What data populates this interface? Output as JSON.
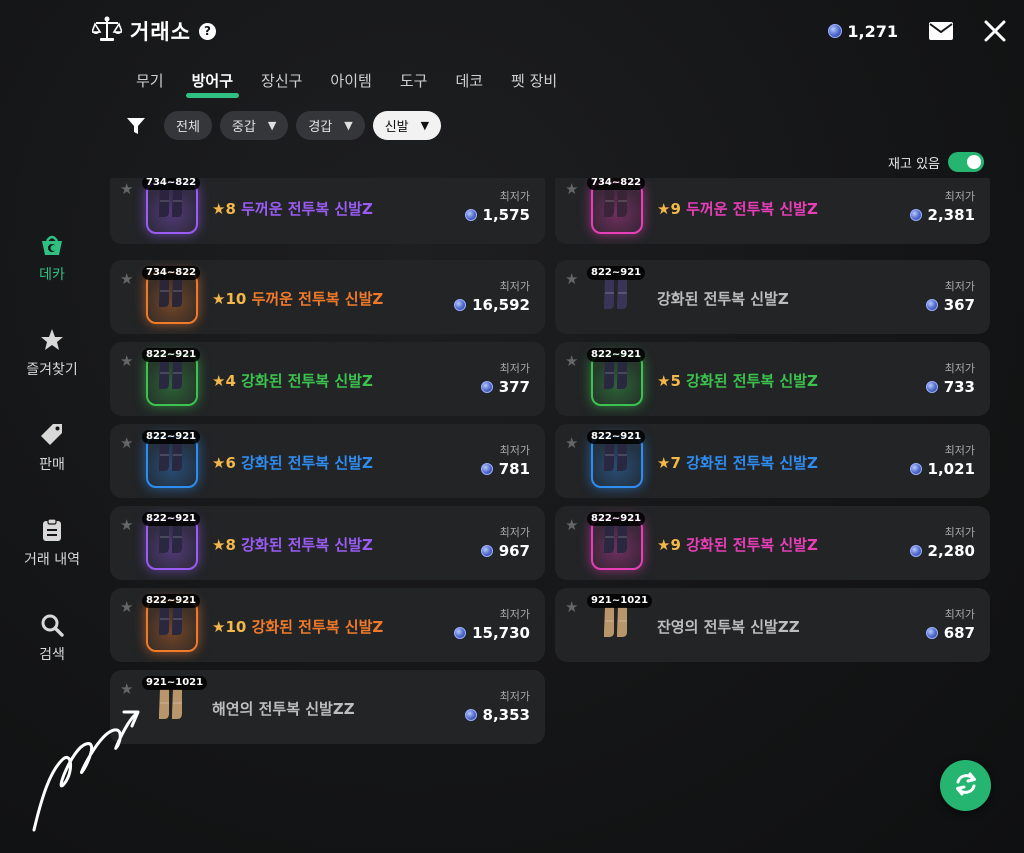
{
  "header": {
    "title": "거래소",
    "currency": "1,271"
  },
  "tabs": [
    {
      "label": "무기",
      "active": false
    },
    {
      "label": "방어구",
      "active": true
    },
    {
      "label": "장신구",
      "active": false
    },
    {
      "label": "아이템",
      "active": false
    },
    {
      "label": "도구",
      "active": false
    },
    {
      "label": "데코",
      "active": false
    },
    {
      "label": "펫 장비",
      "active": false
    }
  ],
  "filters": {
    "all": "전체",
    "heavy": "중갑",
    "light": "경갑",
    "shoes": "신발"
  },
  "stock_toggle": {
    "label": "재고 있음",
    "on": true
  },
  "sidebar": [
    {
      "label": "데카",
      "icon": "basket-icon",
      "active": true
    },
    {
      "label": "즐겨찾기",
      "icon": "star-icon",
      "active": false
    },
    {
      "label": "판매",
      "icon": "tag-icon",
      "active": false
    },
    {
      "label": "거래 내역",
      "icon": "clipboard-icon",
      "active": false
    },
    {
      "label": "검색",
      "icon": "search-icon",
      "active": false
    }
  ],
  "price_label": "최저가",
  "items": [
    {
      "range": "734~822",
      "star": "★8",
      "name": "두꺼운 전투복 신발Z",
      "color": "#9a5cf5",
      "boot": "#2a2440",
      "price": "1,575"
    },
    {
      "range": "734~822",
      "star": "★9",
      "name": "두꺼운 전투복 신발Z",
      "color": "#e83fb8",
      "boot": "#3a2438",
      "price": "2,381"
    },
    {
      "range": "734~822",
      "star": "★10",
      "name": "두꺼운 전투복 신발Z",
      "color": "#f07a2a",
      "boot": "#2a2638",
      "price": "16,592"
    },
    {
      "range": "822~921",
      "star": "",
      "name": "강화된 전투복 신발Z",
      "color": "#bdbdbd",
      "boot": "#3a3558",
      "price": "367"
    },
    {
      "range": "822~921",
      "star": "★4",
      "name": "강화된 전투복 신발Z",
      "color": "#3cc24e",
      "boot": "#2a2840",
      "price": "377"
    },
    {
      "range": "822~921",
      "star": "★5",
      "name": "강화된 전투복 신발Z",
      "color": "#3cc24e",
      "boot": "#2a2840",
      "price": "733"
    },
    {
      "range": "822~921",
      "star": "★6",
      "name": "강화된 전투복 신발Z",
      "color": "#2f8df2",
      "boot": "#2a2840",
      "price": "781"
    },
    {
      "range": "822~921",
      "star": "★7",
      "name": "강화된 전투복 신발Z",
      "color": "#2f8df2",
      "boot": "#2a2840",
      "price": "1,021"
    },
    {
      "range": "822~921",
      "star": "★8",
      "name": "강화된 전투복 신발Z",
      "color": "#9a5cf5",
      "boot": "#2a2840",
      "price": "967"
    },
    {
      "range": "822~921",
      "star": "★9",
      "name": "강화된 전투복 신발Z",
      "color": "#e83fb8",
      "boot": "#2a2840",
      "price": "2,280"
    },
    {
      "range": "822~921",
      "star": "★10",
      "name": "강화된 전투복 신발Z",
      "color": "#f07a2a",
      "boot": "#2a2840",
      "price": "15,730"
    },
    {
      "range": "921~1021",
      "star": "",
      "name": "잔영의 전투복 신발ZZ",
      "color": "#bdbdbd",
      "boot": "#b8956a",
      "price": "687"
    },
    {
      "range": "921~1021",
      "star": "",
      "name": "해연의 전투복 신발ZZ",
      "color": "#bdbdbd",
      "boot": "#b8956a",
      "price": "8,353"
    }
  ]
}
